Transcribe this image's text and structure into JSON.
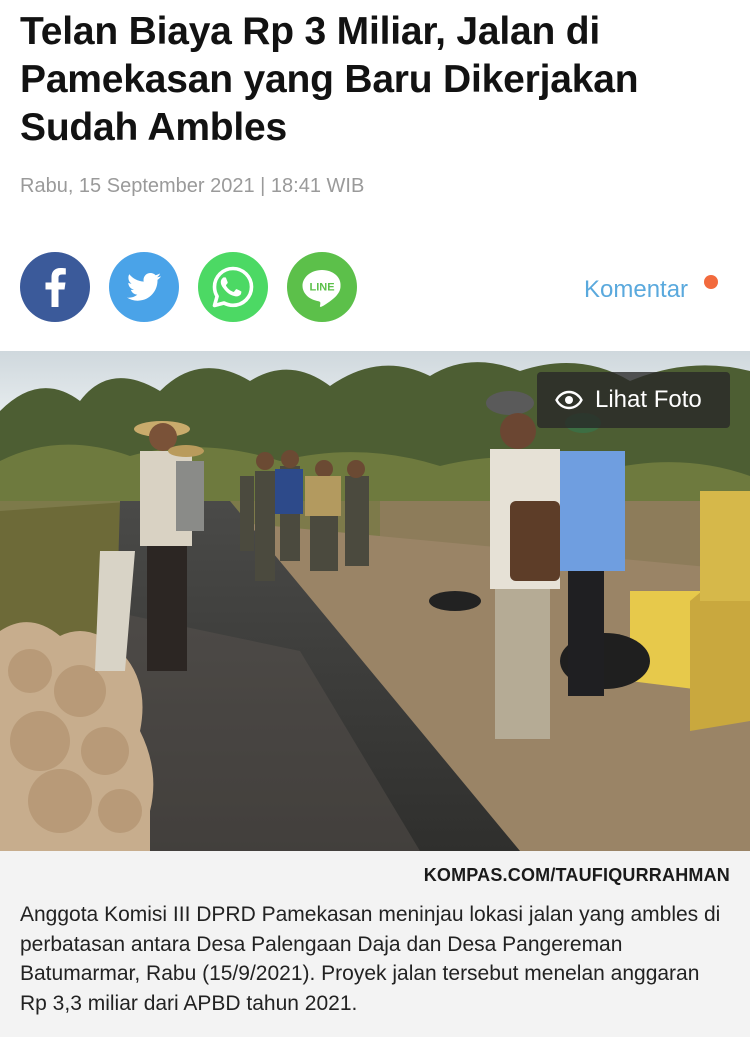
{
  "article": {
    "headline": "Telan Biaya Rp 3 Miliar, Jalan di Pamekasan yang Baru Dikerjakan Sudah Ambles",
    "date": "Rabu, 15 September 2021 | 18:41 WIB"
  },
  "share": {
    "buttons": [
      {
        "icon": "facebook-icon",
        "color": "#3b5a9a"
      },
      {
        "icon": "twitter-icon",
        "color": "#4aa3e8"
      },
      {
        "icon": "whatsapp-icon",
        "color": "#4cd964"
      },
      {
        "icon": "line-icon",
        "color": "#5cc04a",
        "label": "LINE"
      }
    ],
    "comment_label": "Komentar"
  },
  "photo": {
    "view_label": "Lihat Foto",
    "credit": "KOMPAS.COM/TAUFIQURRAHMAN",
    "caption": "Anggota Komisi III DPRD Pamekasan meninjau lokasi jalan yang ambles di perbatasan antara Desa Palengaan Daja dan Desa Pangereman Batumarmar, Rabu (15/9/2021). Proyek jalan tersebut menelan anggaran Rp 3,3 miliar dari APBD tahun 2021."
  },
  "colors": {
    "accent": "#5aa9dd",
    "notification": "#f26a3d"
  }
}
